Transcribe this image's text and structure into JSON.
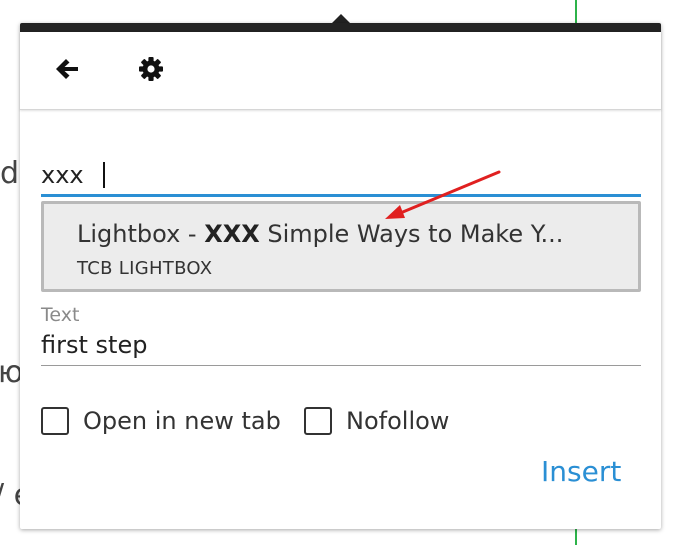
{
  "background": {
    "fragment_1": "ds",
    "fragment_2": "ю",
    "fragment_3": "/ e"
  },
  "toolbar": {
    "back_icon": "arrow-left-icon",
    "settings_icon": "gear-icon"
  },
  "search": {
    "value": "xxx"
  },
  "suggestion": {
    "title_prefix": "Lightbox - ",
    "title_bold": "XXX",
    "title_suffix": " Simple Ways to Make Y...",
    "subtitle": "TCB LIGHTBOX"
  },
  "text_field": {
    "label": "Text",
    "value": "first step"
  },
  "options": {
    "new_tab_label": "Open in new tab",
    "nofollow_label": "Nofollow",
    "new_tab_checked": false,
    "nofollow_checked": false
  },
  "actions": {
    "insert_label": "Insert"
  },
  "colors": {
    "accent": "#2a8fd4",
    "annotation": "#e02020",
    "topbar": "#222222"
  }
}
